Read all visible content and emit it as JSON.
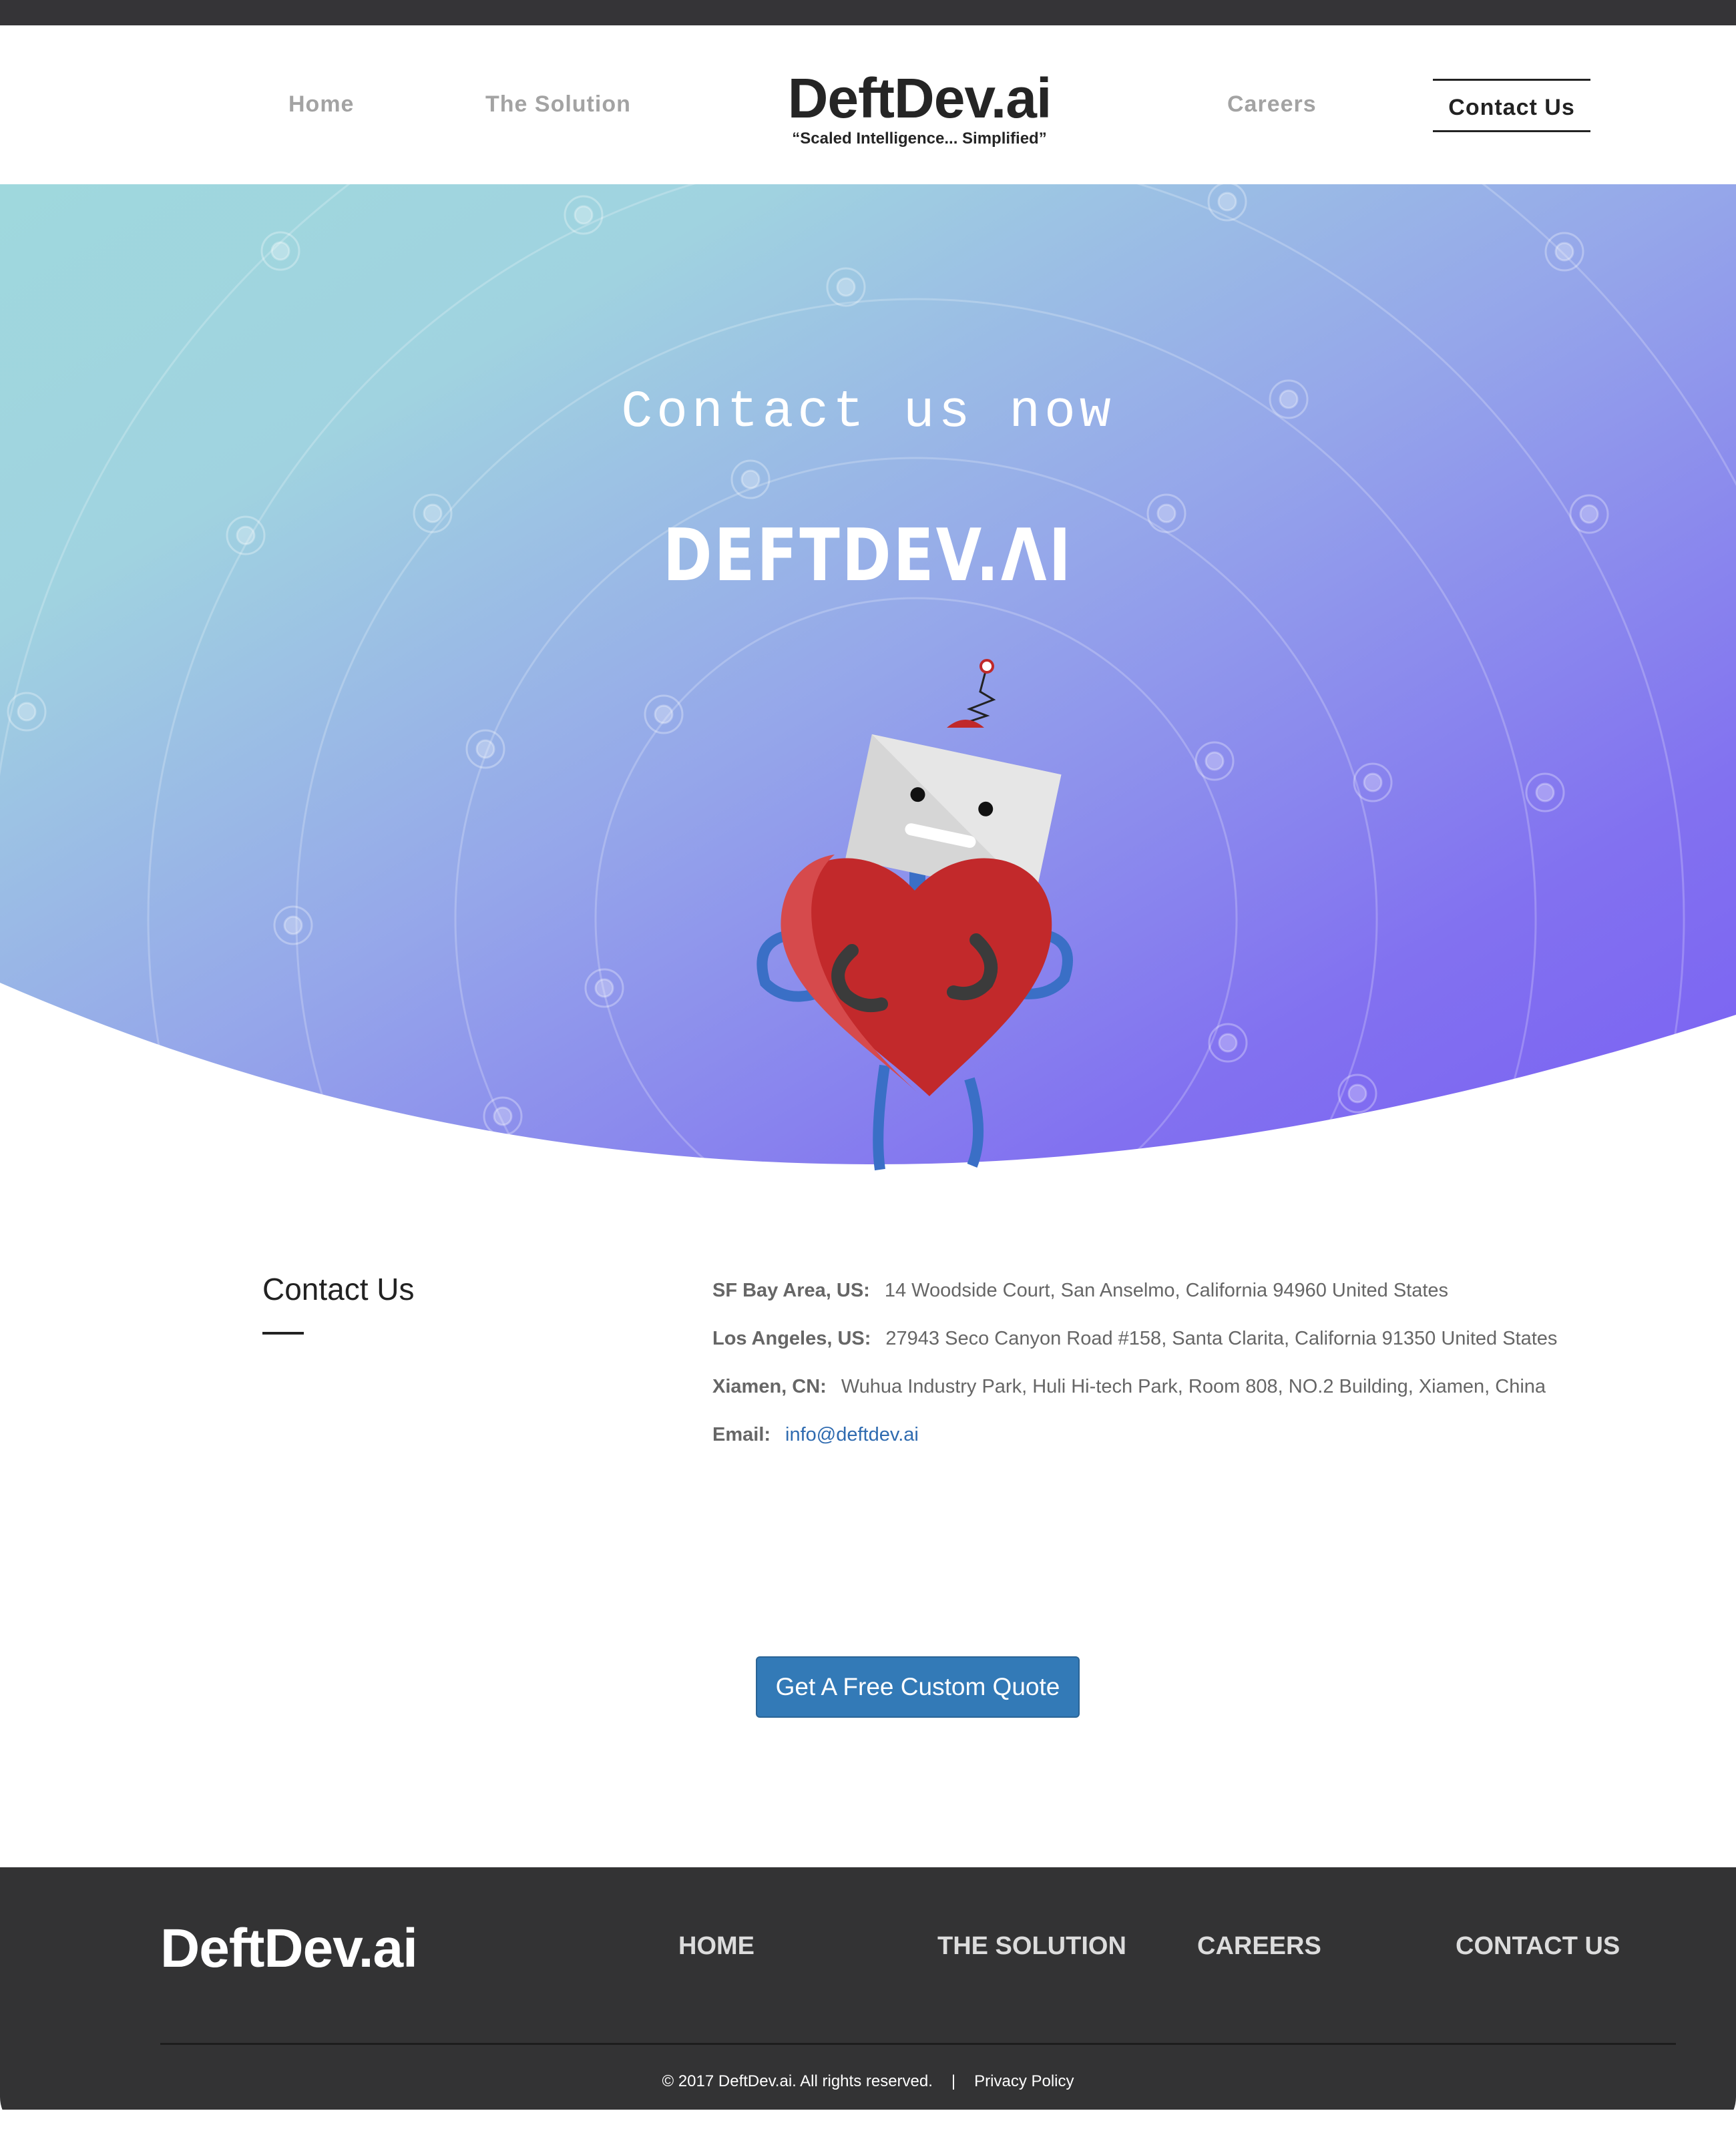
{
  "header": {
    "nav": {
      "home": "Home",
      "solution": "The Solution",
      "careers": "Careers",
      "contact": "Contact Us"
    },
    "brand_title": "DeftDev.ai",
    "brand_tagline": "“Scaled Intelligence... Simplified”"
  },
  "hero": {
    "heading": "Contact us now",
    "logo_text": "DEFTDEV.ΛI",
    "illustration": "robot-holding-heart",
    "gradient": {
      "from": "#9fd8dd",
      "to": "#7b63f2"
    }
  },
  "contact": {
    "title": "Contact Us",
    "rows": [
      {
        "label": "SF Bay Area, US:",
        "value": "14 Woodside Court, San Anselmo, California 94960 United States"
      },
      {
        "label": "Los Angeles, US:",
        "value": "27943 Seco Canyon Road #158, Santa Clarita, California 91350 United States"
      },
      {
        "label": "Xiamen, CN:",
        "value": "Wuhua Industry Park, Huli Hi-tech Park, Room 808, NO.2 Building, Xiamen, China"
      },
      {
        "label": "Email:",
        "value": "info@deftdev.ai"
      }
    ]
  },
  "cta": {
    "label": "Get A Free Custom Quote",
    "color": "#337ab7"
  },
  "footer": {
    "brand": "DeftDev.ai",
    "links": {
      "home": "HOME",
      "solution": "THE SOLUTION",
      "careers": "CAREERS",
      "contact": "CONTACT US"
    },
    "copyright": "© 2017 DeftDev.ai. All rights reserved.",
    "separator": "|",
    "privacy": "Privacy Policy"
  }
}
